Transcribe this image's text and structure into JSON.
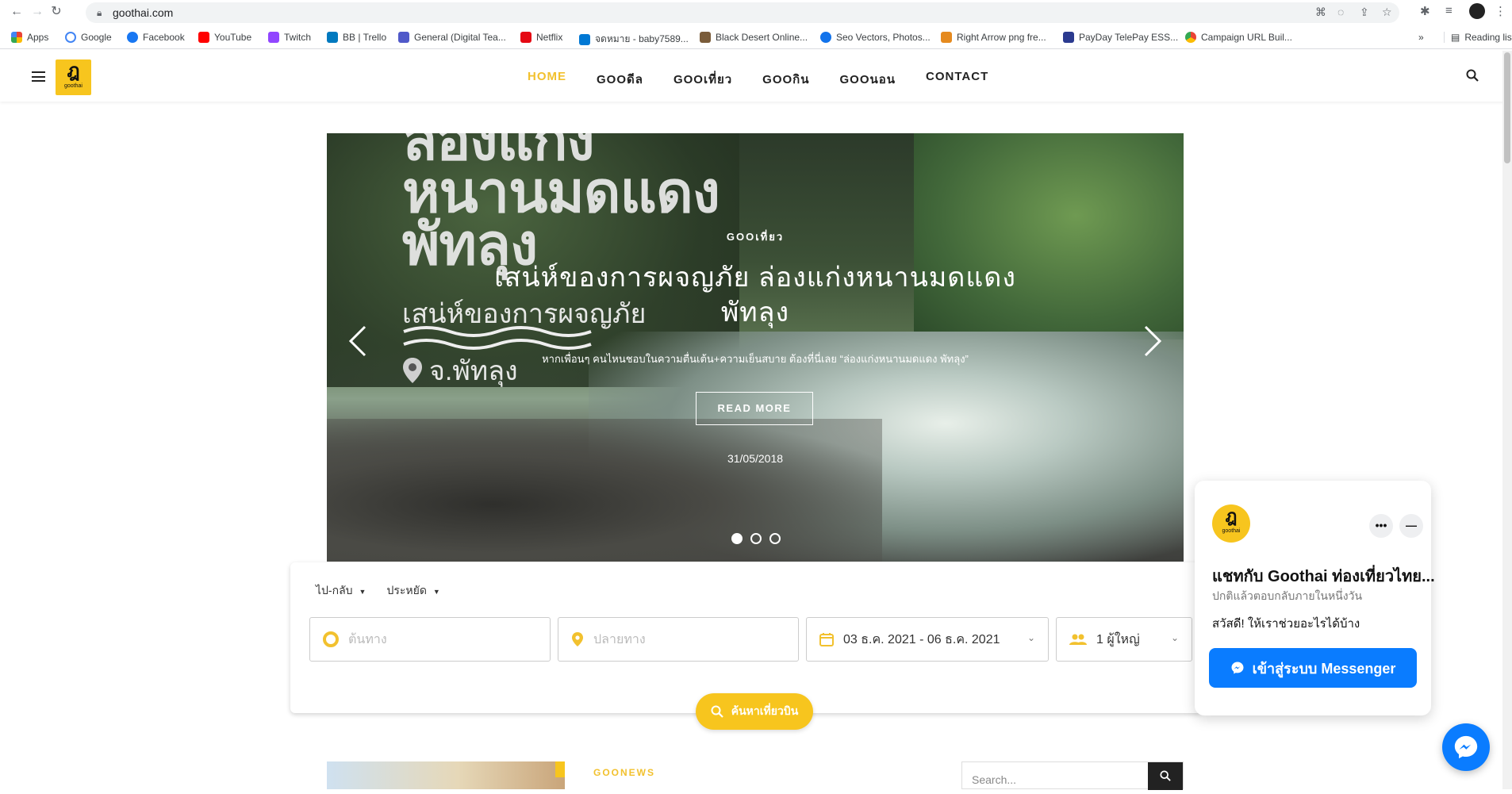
{
  "browser": {
    "url": "goothai.com",
    "bookmarks": [
      {
        "label": "Apps",
        "color": "#e8453c"
      },
      {
        "label": "Google",
        "color": "#4285f4"
      },
      {
        "label": "Facebook",
        "color": "#1877f2"
      },
      {
        "label": "YouTube",
        "color": "#ff0000"
      },
      {
        "label": "Twitch",
        "color": "#9146ff"
      },
      {
        "label": "BB | Trello",
        "color": "#0079bf"
      },
      {
        "label": "General (Digital Tea...",
        "color": "#5059c9"
      },
      {
        "label": "Netflix",
        "color": "#e50914"
      },
      {
        "label": "จดหมาย - baby7589...",
        "color": "#0078d4"
      },
      {
        "label": "Black Desert Online...",
        "color": "#7a5c3a"
      },
      {
        "label": "Seo Vectors, Photos...",
        "color": "#1273eb"
      },
      {
        "label": "Right Arrow png fre...",
        "color": "#e58a1f"
      },
      {
        "label": "PayDay TelePay ESS...",
        "color": "#2b3a8f"
      },
      {
        "label": "Campaign URL Buil...",
        "color": "#fbbc04"
      }
    ],
    "overflow_label": "»",
    "reading_list": "Reading list"
  },
  "header": {
    "logo_glyph": "ฎ",
    "logo_text": "goothai",
    "nav": [
      {
        "label": "HOME",
        "active": true
      },
      {
        "label": "GOOดีล",
        "active": false
      },
      {
        "label": "GOOเที่ยว",
        "active": false
      },
      {
        "label": "GOOกิน",
        "active": false
      },
      {
        "label": "GOOนอน",
        "active": false
      },
      {
        "label": "CONTACT",
        "active": false
      }
    ],
    "accent_color": "#f2c12e"
  },
  "hero": {
    "overlay_title_lines": [
      "ล่องแก่ง",
      "หนานมดแดง",
      "พัทลุง"
    ],
    "overlay_sub": "เสน่ห์ของการผจญภัย",
    "overlay_location": "จ.พัทลุง",
    "category": "GOOเที่ยว",
    "title_line1": "เสน่ห์ของการผจญภัย ล่องแก่งหนานมดแดง",
    "title_line2": "พัทลุง",
    "excerpt": "หากเพื่อนๆ คนไหนชอบในความตื่นเต้น+ความเย็นสบาย ต้องที่นี่เลย “ล่องแก่งหนานมดแดง พัทลุง”",
    "read_more": "READ MORE",
    "date": "31/05/2018",
    "slide_count": 3,
    "active_slide": 1
  },
  "booking": {
    "trip_type": "ไป-กลับ",
    "class": "ประหยัด",
    "origin_placeholder": "ต้นทาง",
    "destination_placeholder": "ปลายทาง",
    "dates": "03 ธ.ค. 2021 - 06 ธ.ค. 2021",
    "passengers": "1 ผู้ใหญ่",
    "search_label": "ค้นหาเที่ยวบิน"
  },
  "news": {
    "section_label": "GOONEWS",
    "search_placeholder": "Search..."
  },
  "chat": {
    "logo_glyph": "ฎ",
    "logo_text": "goothai",
    "title": "แชทกับ Goothai ท่องเที่ยวไทย...",
    "subtitle": "ปกติแล้วตอบกลับภายในหนึ่งวัน",
    "greeting": "สวัสดี! ให้เราช่วยอะไรได้บ้าง",
    "button_label": "เข้าสู่ระบบ Messenger",
    "more_label": "•••",
    "minimize_label": "—"
  }
}
